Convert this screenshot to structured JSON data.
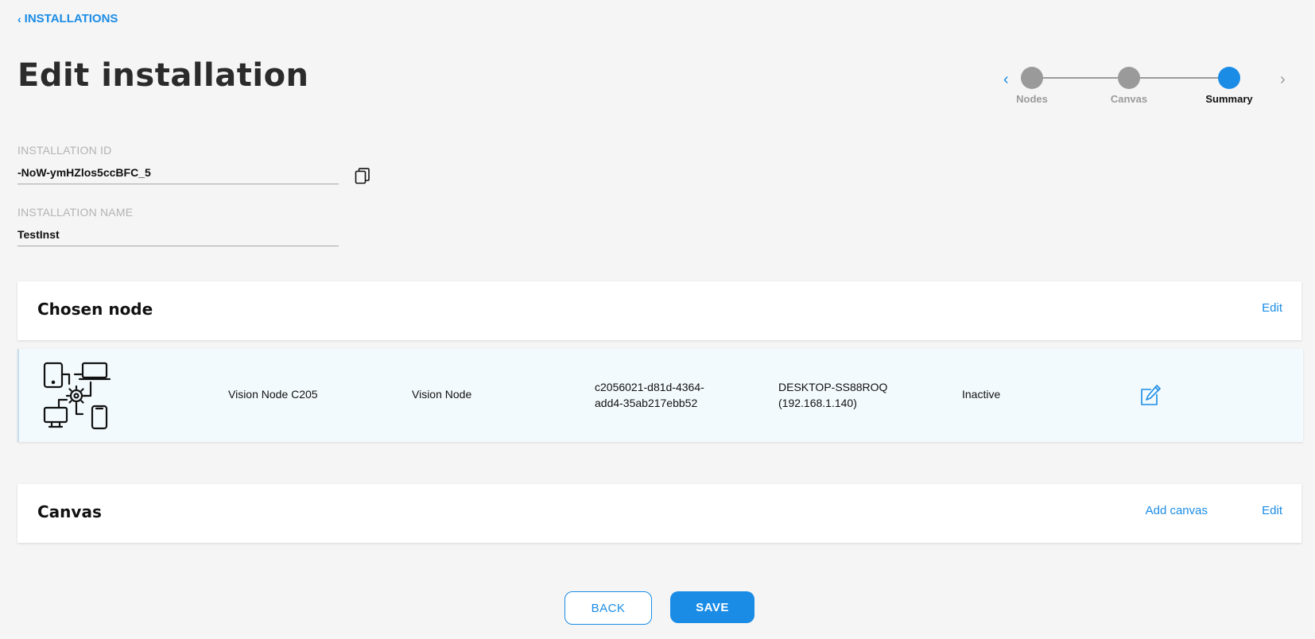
{
  "nav": {
    "back_label": "INSTALLATIONS"
  },
  "page": {
    "title": "Edit installation"
  },
  "stepper": {
    "steps": [
      {
        "label": "Nodes",
        "active": false
      },
      {
        "label": "Canvas",
        "active": false
      },
      {
        "label": "Summary",
        "active": true
      }
    ],
    "prev_icon": "chevron-left-icon",
    "next_icon": "chevron-right-icon"
  },
  "fields": {
    "installation_id": {
      "label": "INSTALLATION ID",
      "value": "-NoW-ymHZlos5ccBFC_5"
    },
    "installation_name": {
      "label": "INSTALLATION NAME",
      "value": "TestInst"
    }
  },
  "chosen_node": {
    "title": "Chosen node",
    "edit_label": "Edit",
    "node": {
      "name": "Vision Node C205",
      "type": "Vision Node",
      "id_line1": "c2056021-d81d-4364-",
      "id_line2": "add4-35ab217ebb52",
      "host_line1": "DESKTOP-SS88ROQ",
      "host_line2": "(192.168.1.140)",
      "status": "Inactive"
    }
  },
  "canvas": {
    "title": "Canvas",
    "add_label": "Add canvas",
    "edit_label": "Edit"
  },
  "actions": {
    "back_label": "BACK",
    "save_label": "SAVE"
  },
  "colors": {
    "accent": "#1a8ce6",
    "inactive_step": "#9a9a9a",
    "background": "#f5f5f5"
  }
}
